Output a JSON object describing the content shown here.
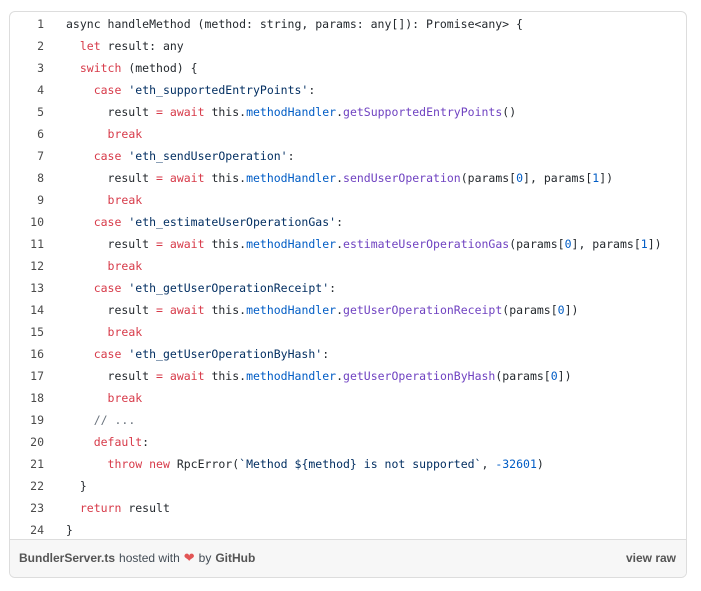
{
  "code_lines": [
    {
      "n": "1",
      "tokens": [
        [
          "plain",
          "async handleMethod (method: string, params: any[]): Promise<any> {"
        ]
      ]
    },
    {
      "n": "2",
      "tokens": [
        [
          "plain",
          "  "
        ],
        [
          "kw",
          "let"
        ],
        [
          "plain",
          " result: any"
        ]
      ]
    },
    {
      "n": "3",
      "tokens": [
        [
          "plain",
          "  "
        ],
        [
          "kw",
          "switch"
        ],
        [
          "plain",
          " (method) {"
        ]
      ]
    },
    {
      "n": "4",
      "tokens": [
        [
          "plain",
          "    "
        ],
        [
          "kw",
          "case"
        ],
        [
          "plain",
          " "
        ],
        [
          "str",
          "'eth_supportedEntryPoints'"
        ],
        [
          "plain",
          ":"
        ]
      ]
    },
    {
      "n": "5",
      "tokens": [
        [
          "plain",
          "      result "
        ],
        [
          "kw",
          "="
        ],
        [
          "plain",
          " "
        ],
        [
          "kw",
          "await"
        ],
        [
          "plain",
          " this."
        ],
        [
          "prop",
          "methodHandler"
        ],
        [
          "plain",
          "."
        ],
        [
          "fn",
          "getSupportedEntryPoints"
        ],
        [
          "plain",
          "()"
        ]
      ]
    },
    {
      "n": "6",
      "tokens": [
        [
          "plain",
          "      "
        ],
        [
          "kw",
          "break"
        ]
      ]
    },
    {
      "n": "7",
      "tokens": [
        [
          "plain",
          "    "
        ],
        [
          "kw",
          "case"
        ],
        [
          "plain",
          " "
        ],
        [
          "str",
          "'eth_sendUserOperation'"
        ],
        [
          "plain",
          ":"
        ]
      ]
    },
    {
      "n": "8",
      "tokens": [
        [
          "plain",
          "      result "
        ],
        [
          "kw",
          "="
        ],
        [
          "plain",
          " "
        ],
        [
          "kw",
          "await"
        ],
        [
          "plain",
          " this."
        ],
        [
          "prop",
          "methodHandler"
        ],
        [
          "plain",
          "."
        ],
        [
          "fn",
          "sendUserOperation"
        ],
        [
          "plain",
          "(params["
        ],
        [
          "num",
          "0"
        ],
        [
          "plain",
          "], params["
        ],
        [
          "num",
          "1"
        ],
        [
          "plain",
          "])"
        ]
      ]
    },
    {
      "n": "9",
      "tokens": [
        [
          "plain",
          "      "
        ],
        [
          "kw",
          "break"
        ]
      ]
    },
    {
      "n": "10",
      "tokens": [
        [
          "plain",
          "    "
        ],
        [
          "kw",
          "case"
        ],
        [
          "plain",
          " "
        ],
        [
          "str",
          "'eth_estimateUserOperationGas'"
        ],
        [
          "plain",
          ":"
        ]
      ]
    },
    {
      "n": "11",
      "tokens": [
        [
          "plain",
          "      result "
        ],
        [
          "kw",
          "="
        ],
        [
          "plain",
          " "
        ],
        [
          "kw",
          "await"
        ],
        [
          "plain",
          " this."
        ],
        [
          "prop",
          "methodHandler"
        ],
        [
          "plain",
          "."
        ],
        [
          "fn",
          "estimateUserOperationGas"
        ],
        [
          "plain",
          "(params["
        ],
        [
          "num",
          "0"
        ],
        [
          "plain",
          "], params["
        ],
        [
          "num",
          "1"
        ],
        [
          "plain",
          "])"
        ]
      ]
    },
    {
      "n": "12",
      "tokens": [
        [
          "plain",
          "      "
        ],
        [
          "kw",
          "break"
        ]
      ]
    },
    {
      "n": "13",
      "tokens": [
        [
          "plain",
          "    "
        ],
        [
          "kw",
          "case"
        ],
        [
          "plain",
          " "
        ],
        [
          "str",
          "'eth_getUserOperationReceipt'"
        ],
        [
          "plain",
          ":"
        ]
      ]
    },
    {
      "n": "14",
      "tokens": [
        [
          "plain",
          "      result "
        ],
        [
          "kw",
          "="
        ],
        [
          "plain",
          " "
        ],
        [
          "kw",
          "await"
        ],
        [
          "plain",
          " this."
        ],
        [
          "prop",
          "methodHandler"
        ],
        [
          "plain",
          "."
        ],
        [
          "fn",
          "getUserOperationReceipt"
        ],
        [
          "plain",
          "(params["
        ],
        [
          "num",
          "0"
        ],
        [
          "plain",
          "])"
        ]
      ]
    },
    {
      "n": "15",
      "tokens": [
        [
          "plain",
          "      "
        ],
        [
          "kw",
          "break"
        ]
      ]
    },
    {
      "n": "16",
      "tokens": [
        [
          "plain",
          "    "
        ],
        [
          "kw",
          "case"
        ],
        [
          "plain",
          " "
        ],
        [
          "str",
          "'eth_getUserOperationByHash'"
        ],
        [
          "plain",
          ":"
        ]
      ]
    },
    {
      "n": "17",
      "tokens": [
        [
          "plain",
          "      result "
        ],
        [
          "kw",
          "="
        ],
        [
          "plain",
          " "
        ],
        [
          "kw",
          "await"
        ],
        [
          "plain",
          " this."
        ],
        [
          "prop",
          "methodHandler"
        ],
        [
          "plain",
          "."
        ],
        [
          "fn",
          "getUserOperationByHash"
        ],
        [
          "plain",
          "(params["
        ],
        [
          "num",
          "0"
        ],
        [
          "plain",
          "])"
        ]
      ]
    },
    {
      "n": "18",
      "tokens": [
        [
          "plain",
          "      "
        ],
        [
          "kw",
          "break"
        ]
      ]
    },
    {
      "n": "19",
      "tokens": [
        [
          "plain",
          "    "
        ],
        [
          "cm",
          "// ..."
        ]
      ]
    },
    {
      "n": "20",
      "tokens": [
        [
          "plain",
          "    "
        ],
        [
          "kw",
          "default"
        ],
        [
          "plain",
          ":"
        ]
      ]
    },
    {
      "n": "21",
      "tokens": [
        [
          "plain",
          "      "
        ],
        [
          "kw",
          "throw"
        ],
        [
          "plain",
          " "
        ],
        [
          "kw",
          "new"
        ],
        [
          "plain",
          " RpcError("
        ],
        [
          "str",
          "`Method ${method} is not supported`"
        ],
        [
          "plain",
          ", "
        ],
        [
          "num",
          "-32601"
        ],
        [
          "plain",
          ")"
        ]
      ]
    },
    {
      "n": "22",
      "tokens": [
        [
          "plain",
          "  }"
        ]
      ]
    },
    {
      "n": "23",
      "tokens": [
        [
          "plain",
          "  "
        ],
        [
          "kw",
          "return"
        ],
        [
          "plain",
          " result"
        ]
      ]
    },
    {
      "n": "24",
      "tokens": [
        [
          "plain",
          "}"
        ]
      ]
    }
  ],
  "footer": {
    "filename": "BundlerServer.ts",
    "hosted_with": "hosted with",
    "heart_icon": "heart-icon",
    "by": "by",
    "brand": "GitHub",
    "view_raw": "view raw"
  },
  "colors": {
    "keyword": "#d73a49",
    "function": "#6f42c1",
    "string": "#032f62",
    "number": "#005cc5",
    "heart": "#e25555"
  }
}
